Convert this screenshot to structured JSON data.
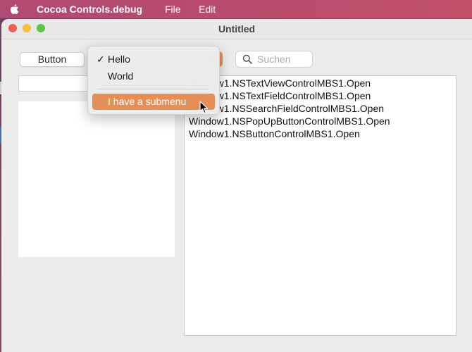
{
  "menubar": {
    "app_name": "Cocoa Controls.debug",
    "items": [
      "File",
      "Edit"
    ]
  },
  "window": {
    "title": "Untitled"
  },
  "controls": {
    "button_label": "Button",
    "search_placeholder": "Suchen"
  },
  "popup_menu": {
    "items": [
      {
        "label": "Hello",
        "checked": true
      },
      {
        "label": "World",
        "checked": false
      },
      {
        "label": "I have a submenu",
        "highlighted": true
      }
    ]
  },
  "text_view": {
    "lines": [
      "Window1.NSTextViewControlMBS1.Open",
      "Window1.NSTextFieldControlMBS1.Open",
      "Window1.NSSearchFieldControlMBS1.Open",
      "Window1.NSPopUpButtonControlMBS1.Open",
      "Window1.NSButtonControlMBS1.Open"
    ]
  },
  "colors": {
    "accent": "#e58e58",
    "menubar": "#b94b6d"
  }
}
